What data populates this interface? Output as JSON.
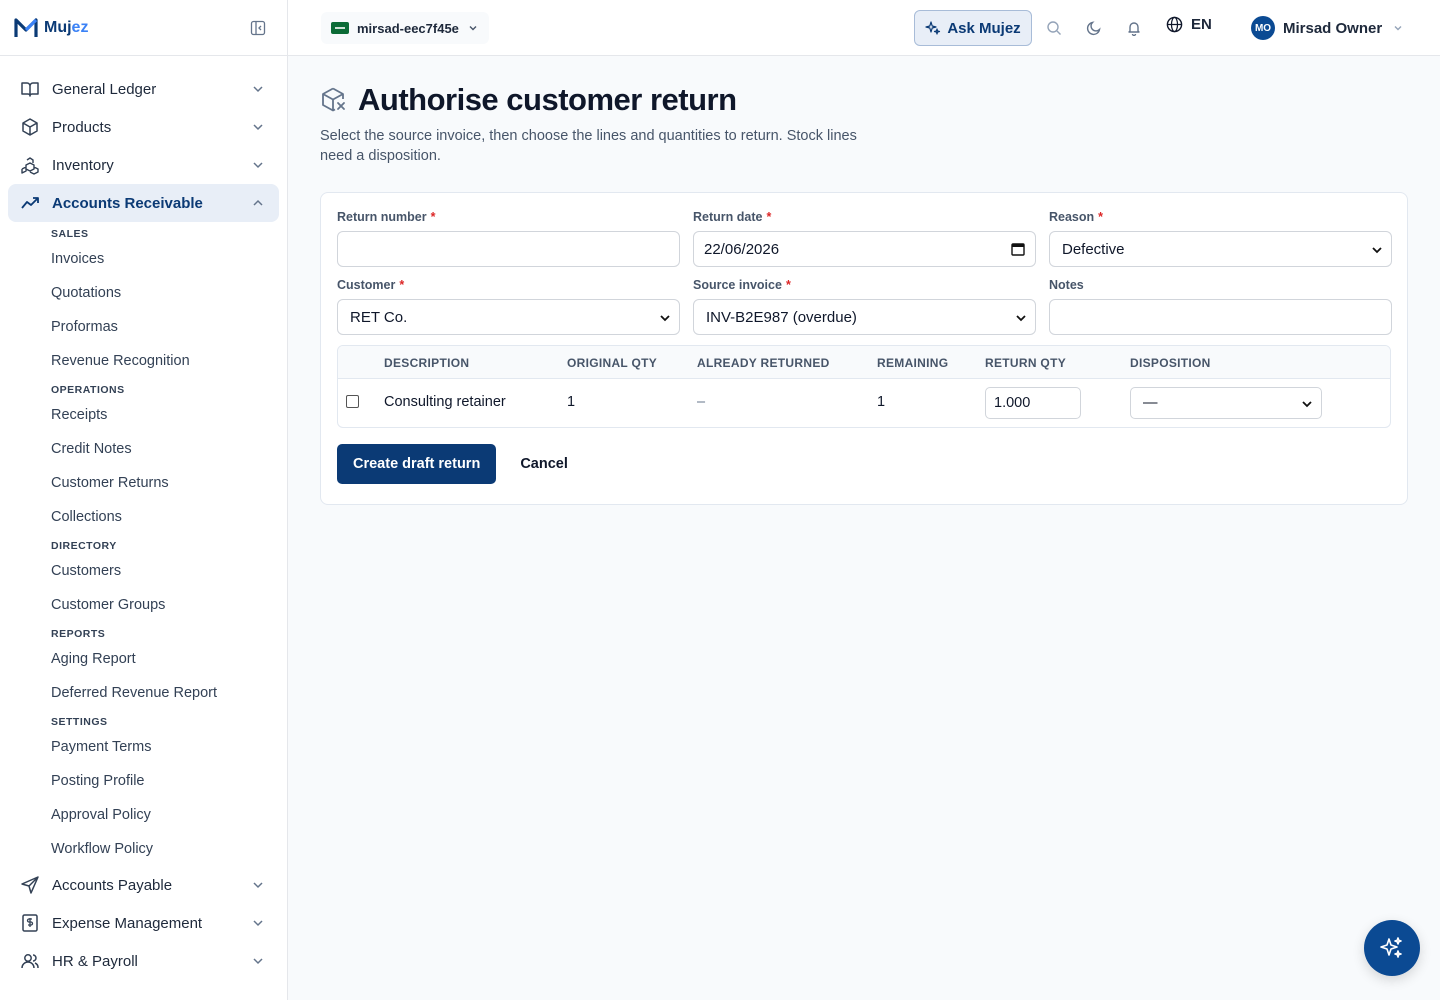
{
  "brand": {
    "name_main": "Muj",
    "name_accent": "ez"
  },
  "topbar": {
    "tenant": "mirsad-eec7f45e",
    "ask_label": "Ask Mujez",
    "lang": "EN",
    "user_initials": "MO",
    "user_name": "Mirsad Owner"
  },
  "sidebar": {
    "general_ledger": "General Ledger",
    "products": "Products",
    "inventory": "Inventory",
    "accounts_receivable": "Accounts Receivable",
    "ar_sections": {
      "sales": "SALES",
      "operations": "OPERATIONS",
      "directory": "DIRECTORY",
      "reports": "REPORTS",
      "settings": "SETTINGS"
    },
    "ar_items": {
      "invoices": "Invoices",
      "quotations": "Quotations",
      "proformas": "Proformas",
      "revenue_recognition": "Revenue Recognition",
      "receipts": "Receipts",
      "credit_notes": "Credit Notes",
      "customer_returns": "Customer Returns",
      "collections": "Collections",
      "customers": "Customers",
      "customer_groups": "Customer Groups",
      "aging_report": "Aging Report",
      "deferred_revenue_report": "Deferred Revenue Report",
      "payment_terms": "Payment Terms",
      "posting_profile": "Posting Profile",
      "approval_policy": "Approval Policy",
      "workflow_policy": "Workflow Policy"
    },
    "accounts_payable": "Accounts Payable",
    "expense_management": "Expense Management",
    "hr_payroll": "HR & Payroll"
  },
  "page": {
    "title": "Authorise customer return",
    "subtitle": "Select the source invoice, then choose the lines and quantities to return. Stock lines need a disposition."
  },
  "form": {
    "return_number": {
      "label": "Return number",
      "value": ""
    },
    "return_date": {
      "label": "Return date",
      "value": "22/06/2026"
    },
    "reason": {
      "label": "Reason",
      "value": "Defective"
    },
    "customer": {
      "label": "Customer",
      "value": "RET Co."
    },
    "source_invoice": {
      "label": "Source invoice",
      "value": "INV-B2E987 (overdue)"
    },
    "notes": {
      "label": "Notes",
      "value": ""
    },
    "required_mark": "*"
  },
  "lines_table": {
    "headers": {
      "description": "DESCRIPTION",
      "original_qty": "ORIGINAL QTY",
      "already_returned": "ALREADY RETURNED",
      "remaining": "REMAINING",
      "return_qty": "RETURN QTY",
      "disposition": "DISPOSITION"
    },
    "rows": [
      {
        "description": "Consulting retainer",
        "original_qty": "1",
        "already_returned": "–",
        "remaining": "1",
        "return_qty": "1.000",
        "disposition": "—"
      }
    ]
  },
  "actions": {
    "create": "Create draft return",
    "cancel": "Cancel"
  },
  "colors": {
    "primary": "#0b3a75",
    "accent": "#3b82f6",
    "required": "#dc2626",
    "active_bg": "#e8eef7"
  }
}
